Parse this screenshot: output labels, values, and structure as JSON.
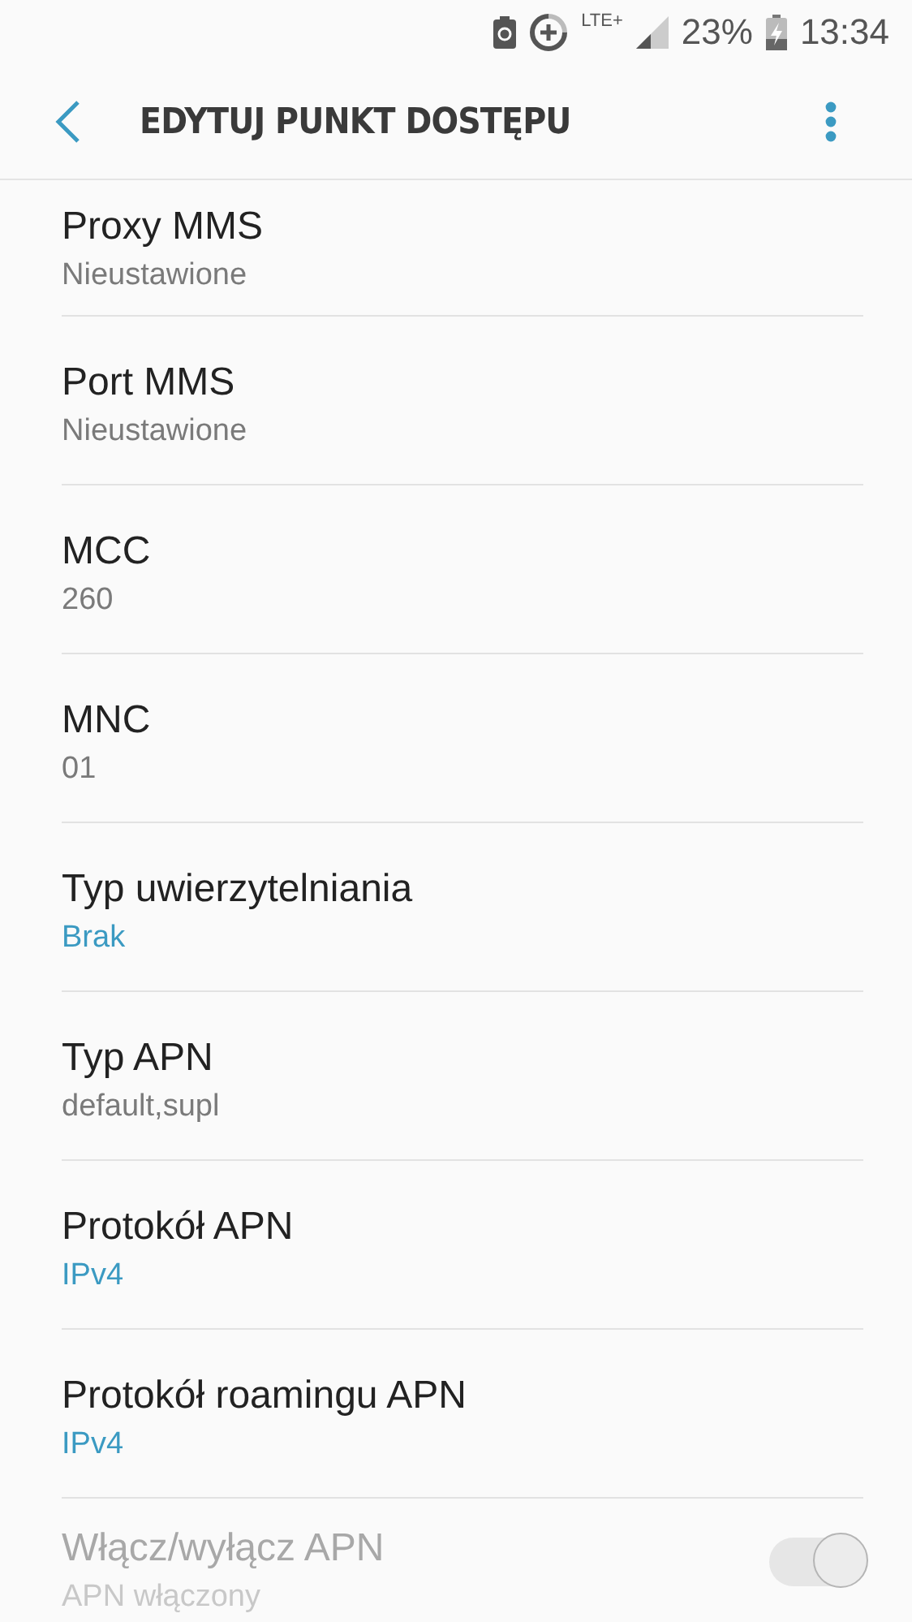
{
  "status_bar": {
    "battery_percent": "23%",
    "time": "13:34",
    "network": "LTE+"
  },
  "toolbar": {
    "title": "EDYTUJ PUNKT DOSTĘPU"
  },
  "settings": [
    {
      "kind": "text",
      "title": "Proxy MMS",
      "value": "Nieustawione",
      "disabled": false
    },
    {
      "kind": "text",
      "title": "Port MMS",
      "value": "Nieustawione",
      "disabled": false
    },
    {
      "kind": "text",
      "title": "MCC",
      "value": "260",
      "disabled": false
    },
    {
      "kind": "text",
      "title": "MNC",
      "value": "01",
      "disabled": false
    },
    {
      "kind": "choice",
      "title": "Typ uwierzytelniania",
      "value": "Brak",
      "disabled": false
    },
    {
      "kind": "text",
      "title": "Typ APN",
      "value": "default,supl",
      "disabled": false
    },
    {
      "kind": "choice",
      "title": "Protokół APN",
      "value": "IPv4",
      "disabled": false
    },
    {
      "kind": "choice",
      "title": "Protokół roamingu APN",
      "value": "IPv4",
      "disabled": false
    },
    {
      "kind": "switch",
      "title": "Włącz/wyłącz APN",
      "value": "APN włączony",
      "disabled": true,
      "on": true
    }
  ]
}
